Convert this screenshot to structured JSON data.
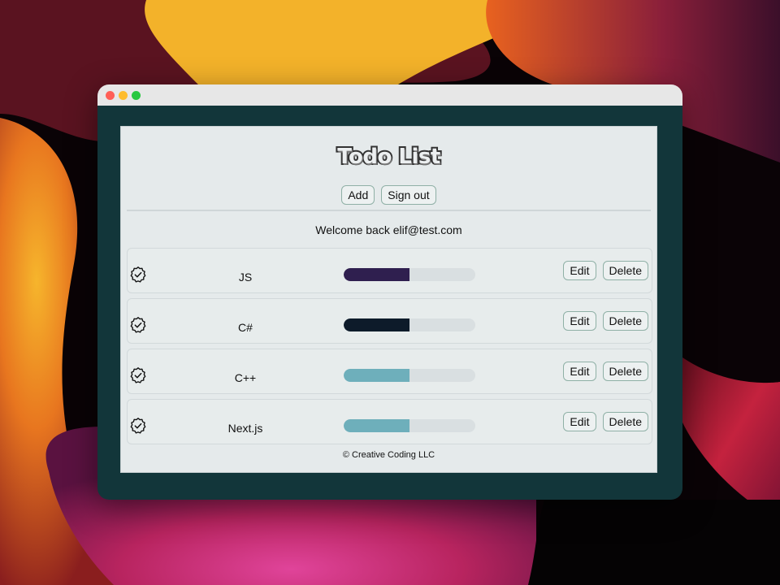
{
  "app": {
    "title": "Todo List",
    "add_label": "Add",
    "signout_label": "Sign out",
    "welcome": "Welcome back elif@test.com",
    "footer": "© Creative Coding LLC"
  },
  "todos": [
    {
      "name": "JS",
      "progress": 0.5,
      "color": "#2f1f4f",
      "edit_label": "Edit",
      "delete_label": "Delete"
    },
    {
      "name": "C#",
      "progress": 0.5,
      "color": "#0d1b2a",
      "edit_label": "Edit",
      "delete_label": "Delete"
    },
    {
      "name": "C++",
      "progress": 0.5,
      "color": "#6eafbb",
      "edit_label": "Edit",
      "delete_label": "Delete"
    },
    {
      "name": "Next.js",
      "progress": 0.5,
      "color": "#6eafbb",
      "edit_label": "Edit",
      "delete_label": "Delete"
    }
  ],
  "icons": {
    "todo_status": "check-badge-icon"
  },
  "colors": {
    "window_frame": "#12363a",
    "app_background": "#e5eaeb",
    "button_border": "#8fb0a6"
  }
}
